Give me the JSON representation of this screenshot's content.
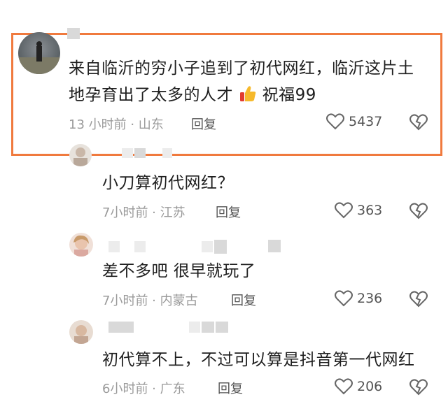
{
  "comments": [
    {
      "text_line1": "来自临沂的穷小子追到了初代网红，临沂这片土",
      "text_line2_a": "地孕育出了太多的人才",
      "emoji": "thumbs-up-icon",
      "text_line2_b": "祝福99",
      "meta": "13 小时前 · 山东",
      "reply": "回复",
      "likes": "5437"
    },
    {
      "text": "小刀算初代网红？",
      "meta": "7小时前 · 江苏",
      "reply": "回复",
      "likes": "363"
    },
    {
      "text": "差不多吧  很早就玩了",
      "meta": "7小时前 · 内蒙古",
      "reply": "回复",
      "likes": "236"
    },
    {
      "text": "初代算不上，不过可以算是抖音第一代网红",
      "meta": "6小时前 · 广东",
      "reply": "回复",
      "likes": "206"
    }
  ],
  "colors": {
    "highlight_border": "#f07a3e",
    "meta_text": "#9a9a9a"
  }
}
